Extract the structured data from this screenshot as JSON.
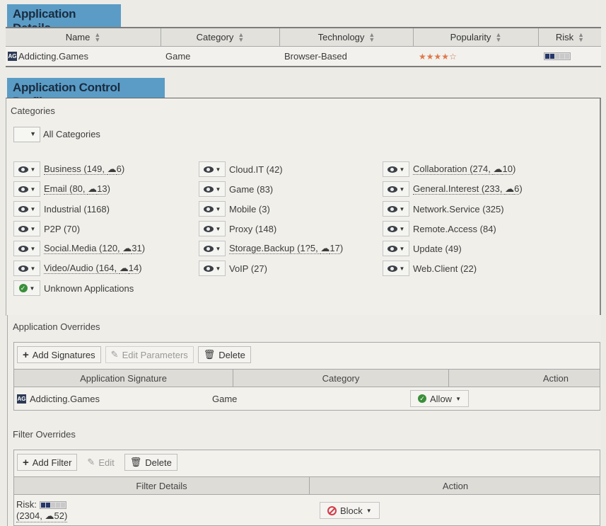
{
  "app_details": {
    "title": "Application Details",
    "columns": [
      "Name",
      "Category",
      "Technology",
      "Popularity",
      "Risk"
    ],
    "row": {
      "icon_text": "AG",
      "name": "Addicting.Games",
      "category": "Game",
      "technology": "Browser-Based",
      "popularity_stars": 4,
      "popularity_max": 5,
      "risk_level": 2,
      "risk_max": 5
    }
  },
  "profile": {
    "title": "Application Control Profile",
    "categories_label": "Categories",
    "all_categories_label": "All Categories",
    "categories": [
      {
        "label": "Business (149, ",
        "cloud": "6",
        "action": "monitor"
      },
      {
        "label": "Email (80, ",
        "cloud": "13",
        "action": "monitor"
      },
      {
        "label": "Industrial (1168)",
        "action": "monitor"
      },
      {
        "label": "P2P (70)",
        "action": "monitor"
      },
      {
        "label": "Social.Media (120, ",
        "cloud": "31",
        "action": "monitor"
      },
      {
        "label": "Video/Audio (164, ",
        "cloud": "14",
        "action": "monitor"
      },
      {
        "label": "Unknown Applications",
        "action": "allow"
      },
      {
        "label": "Cloud.IT (42)",
        "action": "monitor"
      },
      {
        "label": "Game (83)",
        "action": "monitor"
      },
      {
        "label": "Mobile (3)",
        "action": "monitor"
      },
      {
        "label": "Proxy (148)",
        "action": "monitor"
      },
      {
        "label": "Storage.Backup (1?5, ",
        "cloud": "17",
        "action": "monitor"
      },
      {
        "label": "VoIP (27)",
        "action": "monitor"
      },
      {
        "label": "Collaboration (274, ",
        "cloud": "10",
        "action": "monitor"
      },
      {
        "label": "General.Interest (233, ",
        "cloud": "6",
        "action": "monitor"
      },
      {
        "label": "Network.Service (325)",
        "action": "monitor"
      },
      {
        "label": "Remote.Access (84)",
        "action": "monitor"
      },
      {
        "label": "Update (49)",
        "action": "monitor"
      },
      {
        "label": "Web.Client (22)",
        "action": "monitor"
      }
    ]
  },
  "app_overrides": {
    "label": "Application Overrides",
    "buttons": {
      "add": "Add Signatures",
      "edit": "Edit Parameters",
      "delete": "Delete"
    },
    "columns": [
      "Application Signature",
      "Category",
      "Action"
    ],
    "row": {
      "icon_text": "AG",
      "signature": "Addicting.Games",
      "category": "Game",
      "action": "Allow"
    }
  },
  "filter_overrides": {
    "label": "Filter Overrides",
    "buttons": {
      "add": "Add Filter",
      "edit": "Edit",
      "delete": "Delete"
    },
    "columns": [
      "Filter Details",
      "Action"
    ],
    "row": {
      "risk_label": "Risk:",
      "risk_level": 2,
      "risk_max": 5,
      "count_prefix": "(2304, ",
      "cloud": "52",
      "count_suffix": ")",
      "action": "Block"
    }
  },
  "colors": {
    "title_bg": "#5a9cc6",
    "star": "#e0784a",
    "risk_on": "#25366a",
    "allow": "#3a8f3a",
    "block": "#d43b4a"
  }
}
